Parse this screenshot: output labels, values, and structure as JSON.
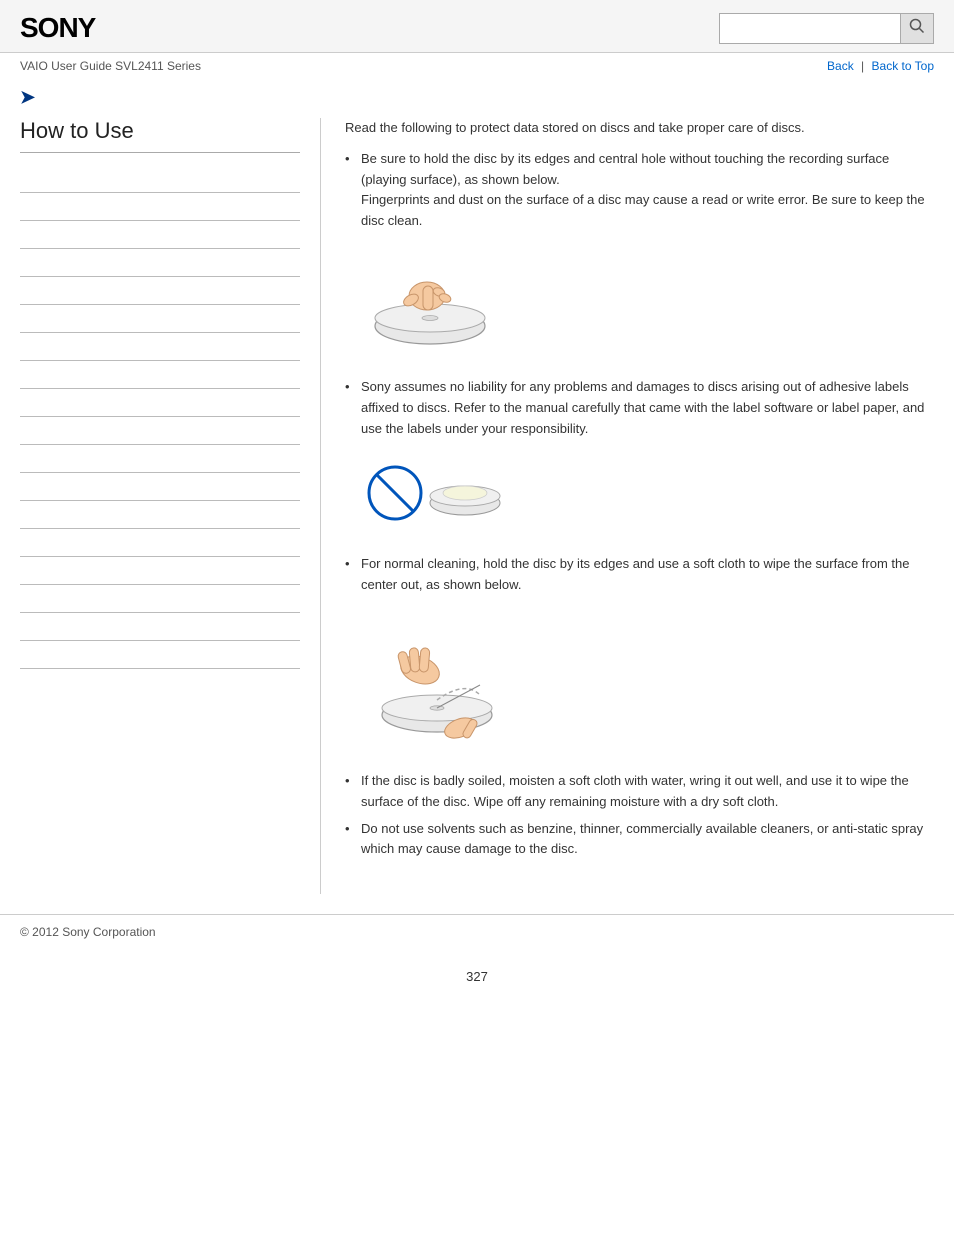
{
  "header": {
    "logo": "SONY",
    "search_placeholder": "",
    "search_icon": "🔍"
  },
  "nav": {
    "guide_text": "VAIO User Guide SVL2411 Series",
    "back_label": "Back",
    "back_to_top_label": "Back to Top",
    "separator": "|"
  },
  "sidebar": {
    "title": "How to Use",
    "lines_count": 18
  },
  "content": {
    "intro": "Read the following to protect data stored on discs and take proper care of discs.",
    "bullet1_main": "Be sure to hold the disc by its edges and central hole without touching the recording surface (playing surface), as shown below.",
    "bullet1_sub": "Fingerprints and dust on the surface of a disc may cause a read or write error. Be sure to keep the disc clean.",
    "bullet2": "Sony assumes no liability for any problems and damages to discs arising out of adhesive labels affixed to discs. Refer to the manual carefully that came with the label software or label paper, and use the labels under your responsibility.",
    "bullet3_main": "For normal cleaning, hold the disc by its edges and use a soft cloth to wipe the surface from the center out, as shown below.",
    "bullet4": "If the disc is badly soiled, moisten a soft cloth with water, wring it out well, and use it to wipe the surface of the disc. Wipe off any remaining moisture with a dry soft cloth.",
    "bullet5": "Do not use solvents such as benzine, thinner, commercially available cleaners, or anti-static spray which may cause damage to the disc."
  },
  "footer": {
    "copyright": "© 2012 Sony Corporation",
    "page_number": "327"
  }
}
